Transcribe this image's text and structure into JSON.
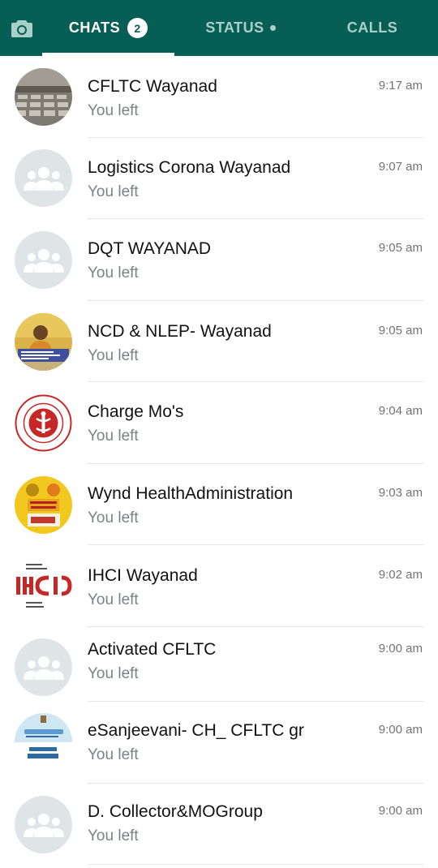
{
  "tabs": {
    "camera_icon": "camera-icon",
    "chats_label": "CHATS",
    "chats_count": "2",
    "status_label": "STATUS",
    "calls_label": "CALLS"
  },
  "colors": {
    "header": "#075e54",
    "active_tab": "#ffffff",
    "inactive_tab": "#a9cfc9",
    "default_avatar": "#dfe5e7"
  },
  "chats": [
    {
      "name": "CFLTC Wayanad",
      "preview": "You left",
      "time": "9:17 am",
      "avatar": "photo-avatar"
    },
    {
      "name": "Logistics Corona Wayanad",
      "preview": "You left",
      "time": "9:07 am",
      "avatar": "group-icon"
    },
    {
      "name": "DQT WAYANAD",
      "preview": "You left",
      "time": "9:05 am",
      "avatar": "group-icon"
    },
    {
      "name": "NCD & NLEP- Wayanad",
      "preview": "You left",
      "time": "9:05 am",
      "avatar": "photo-avatar"
    },
    {
      "name": "Charge Mo's",
      "preview": "You left",
      "time": "9:04 am",
      "avatar": "seal-avatar"
    },
    {
      "name": "Wynd HealthAdministration",
      "preview": "You left",
      "time": "9:03 am",
      "avatar": "photo-avatar"
    },
    {
      "name": "IHCI Wayanad",
      "preview": "You left",
      "time": "9:02 am",
      "avatar": "logo-avatar"
    },
    {
      "name": "Activated CFLTC",
      "preview": "You left",
      "time": "9:00 am",
      "avatar": "group-icon"
    },
    {
      "name": "eSanjeevani- CH_ CFLTC gr",
      "preview": "You left",
      "time": "9:00 am",
      "avatar": "logo-avatar"
    },
    {
      "name": "D. Collector&MOGroup",
      "preview": "You left",
      "time": "9:00 am",
      "avatar": "group-icon"
    }
  ]
}
